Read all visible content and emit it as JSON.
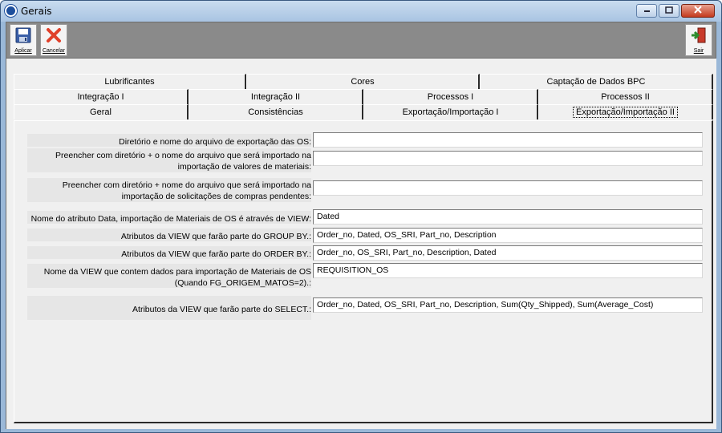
{
  "window": {
    "title": "Gerais",
    "icons": [
      "app-icon",
      "minimize-icon",
      "maximize-icon",
      "close-icon"
    ]
  },
  "toolbar": {
    "apply_label": "Aplicar",
    "cancel_label": "Cancelar",
    "exit_label": "Sair",
    "icons": [
      "save-disk-icon",
      "cancel-x-icon",
      "exit-door-icon"
    ],
    "colors": {
      "cancel": "#e0402a",
      "exit_arrow": "#2c8c2c",
      "exit_door": "#c83a2a"
    }
  },
  "tabs": {
    "row1": [
      "Lubrificantes",
      "Cores",
      "Captação de Dados BPC"
    ],
    "row2": [
      "Integração I",
      "Integração II",
      "Processos I",
      "Processos II"
    ],
    "row3": [
      "Geral",
      "Consistências",
      "Exportação/Importação I",
      "Exportação/Importação II"
    ],
    "selected": "Exportação/Importação II"
  },
  "fields": [
    {
      "label": "Diretório e nome do arquivo de exportação das OS:",
      "value": ""
    },
    {
      "label": "Preencher com diretório + o nome do arquivo que será importado na importação de valores de materiais:",
      "value": ""
    },
    {
      "label": "Preencher com diretório + nome do arquivo que será importado na importação de solicitações de compras pendentes:",
      "value": ""
    },
    {
      "label": "Nome do atributo Data, importação de Materiais de OS é através de VIEW:",
      "value": "Dated"
    },
    {
      "label": "Atributos da VIEW que farão parte do GROUP BY.:",
      "value": "Order_no, Dated, OS_SRI, Part_no, Description"
    },
    {
      "label": "Atributos da VIEW que farão parte do ORDER BY.:",
      "value": "Order_no, OS_SRI, Part_no, Description, Dated"
    },
    {
      "label": "Nome da VIEW que contem dados para importação de Materiais de OS (Quando FG_ORIGEM_MATOS=2).:",
      "value": "REQUISITION_OS"
    },
    {
      "label": "Atributos da VIEW que farão parte do SELECT.:",
      "value": "Order_no, Dated, OS_SRI, Part_no, Description, Sum(Qty_Shipped), Sum(Average_Cost)"
    }
  ]
}
